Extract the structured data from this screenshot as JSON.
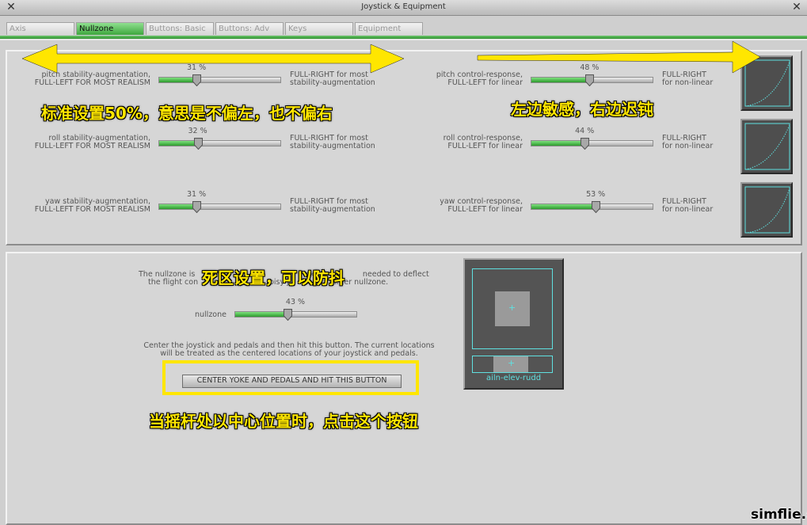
{
  "window": {
    "title": "Joystick & Equipment"
  },
  "tabs": [
    {
      "label": "Axis",
      "active": false
    },
    {
      "label": "Nullzone",
      "active": true
    },
    {
      "label": "Buttons: Basic",
      "active": false
    },
    {
      "label": "Buttons: Adv",
      "active": false
    },
    {
      "label": "Keys",
      "active": false
    },
    {
      "label": "Equipment",
      "active": false
    }
  ],
  "stability": [
    {
      "left": "pitch stability-augmentation,",
      "left2": "FULL-LEFT FOR MOST REALISM",
      "right": "FULL-RIGHT for most",
      "right2": "stability-augmentation",
      "pct": "31 %",
      "value": 0.31
    },
    {
      "left": "roll stability-augmentation,",
      "left2": "FULL-LEFT FOR MOST REALISM",
      "right": "FULL-RIGHT for most",
      "right2": "stability-augmentation",
      "pct": "32 %",
      "value": 0.32
    },
    {
      "left": "yaw stability-augmentation,",
      "left2": "FULL-LEFT FOR MOST REALISM",
      "right": "FULL-RIGHT for most",
      "right2": "stability-augmentation",
      "pct": "31 %",
      "value": 0.31
    }
  ],
  "response": [
    {
      "left": "pitch control-response,",
      "left2": "FULL-LEFT for linear",
      "right": "FULL-RIGHT",
      "right2": "for non-linear",
      "pct": "48 %",
      "value": 0.48
    },
    {
      "left": "roll control-response,",
      "left2": "FULL-LEFT for linear",
      "right": "FULL-RIGHT",
      "right2": "for non-linear",
      "pct": "44 %",
      "value": 0.44
    },
    {
      "left": "yaw control-response,",
      "left2": "FULL-LEFT for linear",
      "right": "FULL-RIGHT",
      "right2": "for non-linear",
      "pct": "53 %",
      "value": 0.53
    }
  ],
  "nullzone": {
    "desc1": "The nullzone is",
    "desc1b": "ck o",
    "desc1c": "needed to deflect",
    "desc2": "the flight con",
    "desc2b": "oisy j",
    "desc2c": "arger nullzone.",
    "label": "nullzone",
    "pct": "43 %",
    "value": 0.43,
    "center_text1": "Center the joystick and pedals and then hit this button. The current locations",
    "center_text2": "will be treated as the centered locations of your joystick and pedals.",
    "button": "CENTER YOKE AND PEDALS AND HIT THIS BUTTON",
    "display_label": "ailn-elev-rudd"
  },
  "annotations": {
    "a1": "标准设置50%，意思是不偏左，也不偏右",
    "a2": "左边敏感，右边迟钝",
    "a3": "死区设置，可以防抖",
    "a4": "当摇杆处以中心位置时，点击这个按钮"
  },
  "watermark": "simflie.cn",
  "colors": {
    "accent_green": "#3ea63e",
    "annotation_yellow": "#ffe600",
    "curve_cyan": "#5fe0e0"
  }
}
